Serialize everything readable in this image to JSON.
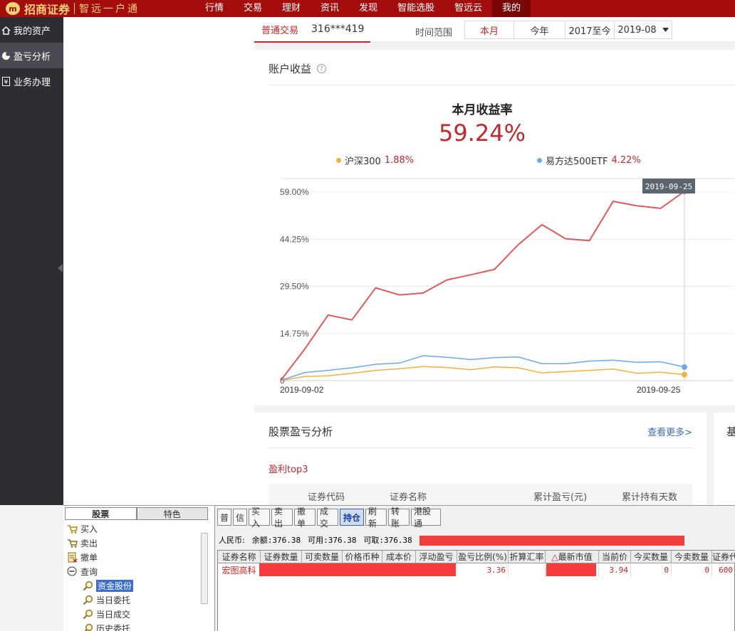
{
  "topbar": {
    "brand": "招商证券",
    "slogan": "智远一户通",
    "nav": [
      "行情",
      "交易",
      "理财",
      "资讯",
      "发现",
      "智能选股",
      "智远云",
      "我的"
    ],
    "active_nav": "我的",
    "brand_color": "#a30d0d"
  },
  "sidebar": {
    "items": [
      {
        "label": "我的资产",
        "icon": "home-icon"
      },
      {
        "label": "盈亏分析",
        "icon": "pie-chart-icon"
      },
      {
        "label": "业务办理",
        "icon": "yen-icon"
      }
    ],
    "active": "盈亏分析"
  },
  "header": {
    "account_tab": "普通交易",
    "account_no": "316***419",
    "range_label": "时间范围",
    "ranges": [
      "本月",
      "今年",
      "2017至今"
    ],
    "active_range": "本月",
    "month_select": "2019-08"
  },
  "income": {
    "title": "账户收益",
    "rate_label": "本月收益率",
    "rate_value": "59.24%",
    "bench1_name": "沪深300",
    "bench1_value": "1.88%",
    "bench2_name": "易方达500ETF",
    "bench2_value": "4.22%"
  },
  "chart_data": {
    "type": "line",
    "x_start_label": "2019-09-02",
    "x_end_label": "2019-09-25",
    "tooltip": "2019-09-25",
    "y_ticks": [
      "59.00%",
      "44.25%",
      "29.50%",
      "14.75%",
      "0"
    ],
    "ylim": [
      0,
      59
    ],
    "series": [
      {
        "color": "#e05a5a",
        "values": [
          0,
          9.7,
          20.5,
          19.0,
          29.0,
          26.8,
          27.4,
          31.5,
          33.1,
          34.8,
          42.5,
          48.8,
          44.4,
          43.8,
          56.1,
          54.7,
          53.9,
          59.24
        ]
      },
      {
        "color": "#6fa8e8",
        "values": [
          0,
          2.5,
          3.2,
          4.0,
          5.1,
          5.5,
          7.8,
          7.3,
          6.6,
          7.2,
          7.4,
          5.3,
          5.3,
          6.1,
          6.4,
          5.7,
          5.9,
          4.22
        ]
      },
      {
        "color": "#f0b23d",
        "values": [
          0,
          1.3,
          1.5,
          2.3,
          3.2,
          3.7,
          4.4,
          4.1,
          3.4,
          4.3,
          4.0,
          2.4,
          2.8,
          3.2,
          3.6,
          2.3,
          2.6,
          1.88
        ]
      }
    ]
  },
  "analysis": {
    "title": "股票盈亏分析",
    "more": "查看更多>",
    "sub": "盈利top3",
    "columns": [
      "证券代码",
      "证券名称",
      "累计盈亏(元)",
      "累计持有天数"
    ],
    "right_stub": "基"
  },
  "tree": {
    "tabs": [
      "股票",
      "特色"
    ],
    "active_tab": "股票",
    "items": [
      {
        "label": "买入",
        "icon": "buy-icon",
        "child": false
      },
      {
        "label": "卖出",
        "icon": "sell-icon",
        "child": false
      },
      {
        "label": "撤单",
        "icon": "cancel-order-icon",
        "child": false
      },
      {
        "label": "查询",
        "icon": "minus-circle-icon",
        "child": false
      },
      {
        "label": "资金股份",
        "icon": "magnifier-icon",
        "child": true
      },
      {
        "label": "当日委托",
        "icon": "magnifier-icon",
        "child": true
      },
      {
        "label": "当日成交",
        "icon": "magnifier-icon",
        "child": true
      },
      {
        "label": "历史委托",
        "icon": "magnifier-icon",
        "child": true
      }
    ],
    "selected": "资金股份"
  },
  "panel": {
    "toolbar": [
      "普",
      "信",
      "买入",
      "卖出",
      "撤单",
      "成交",
      "持仓",
      "刷新",
      "转账",
      "港股通"
    ],
    "active": "持仓",
    "balance": {
      "currency": "人民币:",
      "balance": "余额:376.38",
      "available": "可用:376.38",
      "withdrawable": "可取:376.38"
    },
    "columns": [
      "证券名称",
      "证券数量",
      "可卖数量",
      "价格币种",
      "成本价",
      "浮动盈亏",
      "盈亏比例(%)",
      "折算汇率",
      "最新市值",
      "当前价",
      "今买数量",
      "今卖数量",
      "证券代"
    ],
    "sort_column": "最新市值",
    "row": {
      "name": "宏图高科",
      "ratio": "3.36",
      "price": "3.94",
      "buy_qty": "0",
      "sell_qty": "0",
      "code": "600"
    }
  }
}
